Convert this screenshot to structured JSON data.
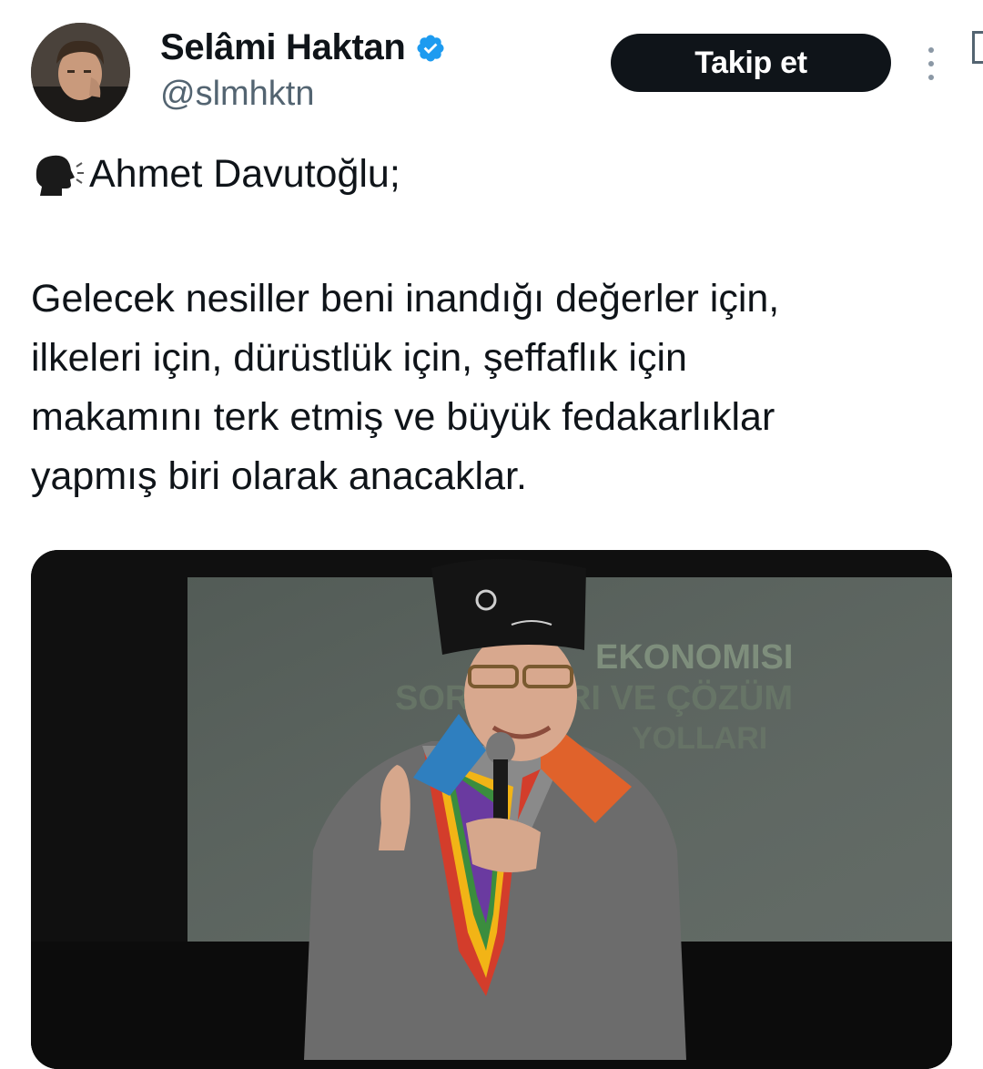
{
  "author": {
    "display_name": "Selâmi Haktan",
    "handle": "@slmhktn",
    "verified": true,
    "verified_color": "#1d9bf0"
  },
  "actions": {
    "follow_label": "Takip et",
    "more_icon": "more-vertical-icon"
  },
  "tweet": {
    "speaker_icon": "speaking-head-icon",
    "line1": "Ahmet Davutoğlu;",
    "body": "Gelecek nesiller beni inandığı değerler için,\nilkeleri için, dürüstlük için, şeffaflık için\nmakamını terk etmiş ve büyük fedakarlıklar\nyapmış biri olarak anacaklar."
  },
  "media": {
    "screen_text_line1": "EKONOMISI",
    "screen_text_line2": "SORUNLARI VE ÇÖZÜM",
    "screen_text_line3": "YOLLARI",
    "screen_color": "#5d6660",
    "screen_text_color": "#7c8d7a"
  }
}
